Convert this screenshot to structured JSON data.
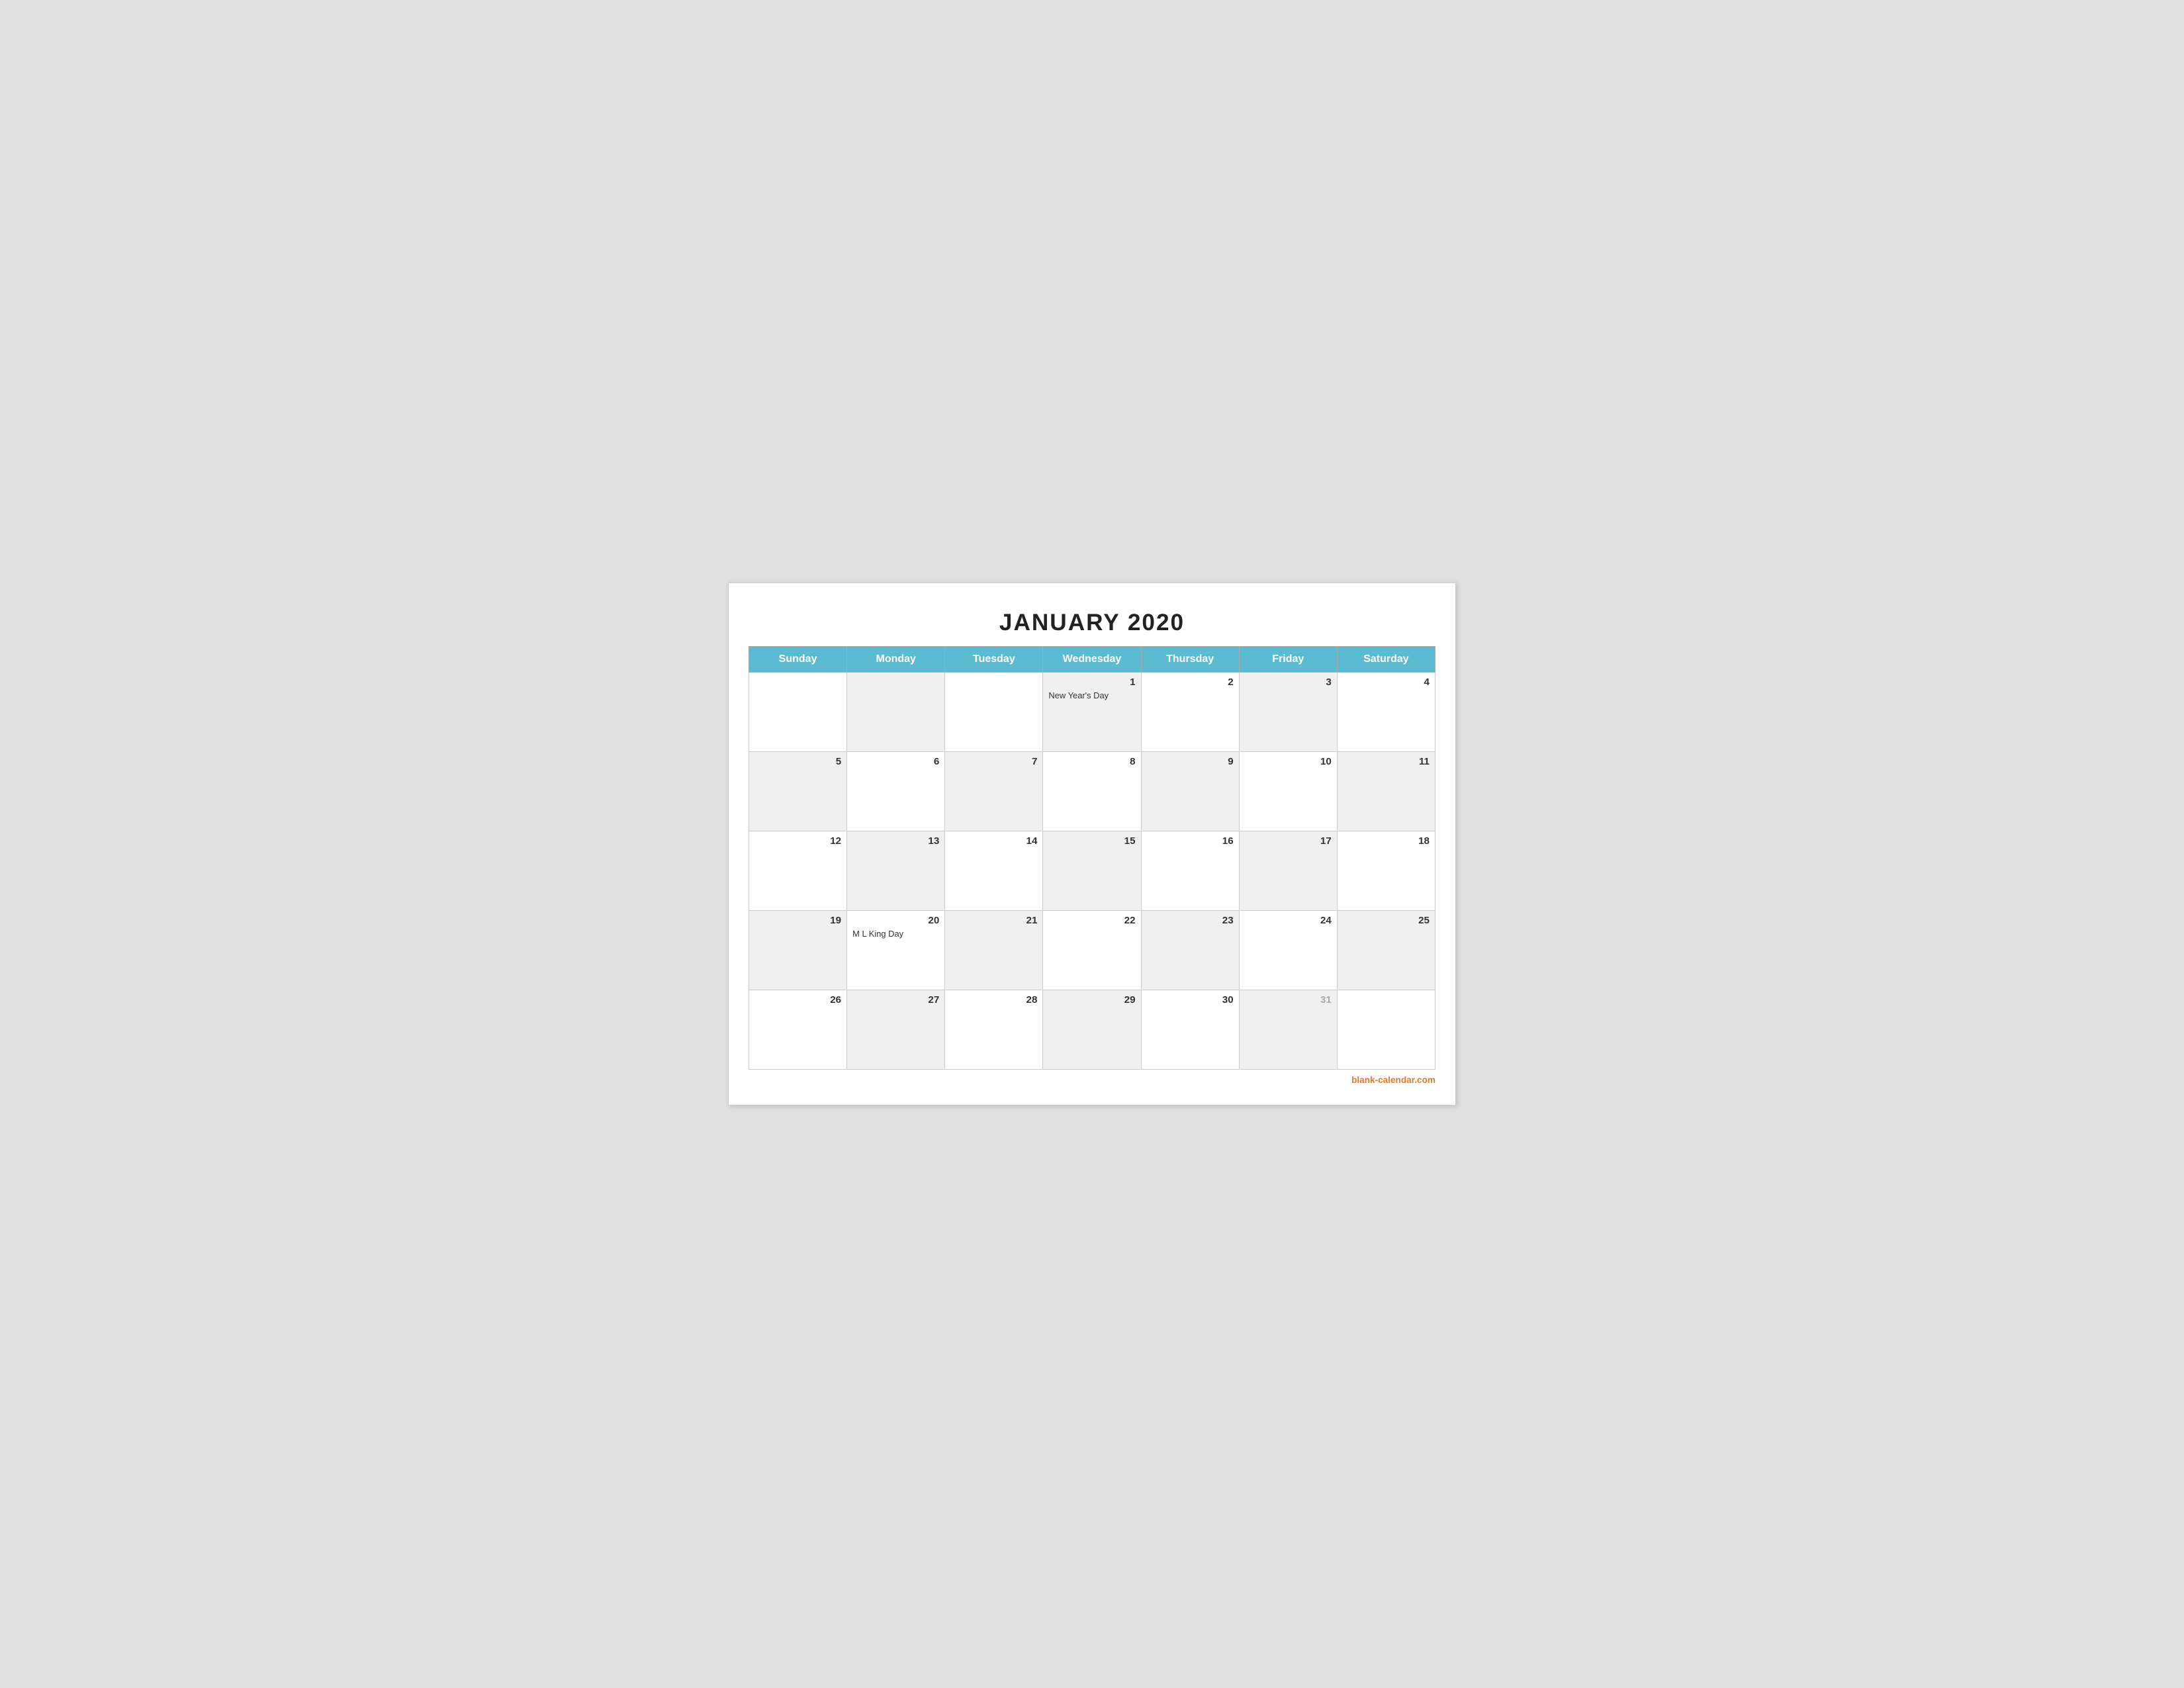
{
  "calendar": {
    "title": "JANUARY 2020",
    "headers": [
      "Sunday",
      "Monday",
      "Tuesday",
      "Wednesday",
      "Thursday",
      "Friday",
      "Saturday"
    ],
    "weeks": [
      [
        {
          "day": "",
          "holiday": "",
          "bg": "white"
        },
        {
          "day": "",
          "holiday": "",
          "bg": "gray"
        },
        {
          "day": "",
          "holiday": "",
          "bg": "white"
        },
        {
          "day": "1",
          "holiday": "New Year's Day",
          "bg": "gray"
        },
        {
          "day": "2",
          "holiday": "",
          "bg": "white"
        },
        {
          "day": "3",
          "holiday": "",
          "bg": "gray"
        },
        {
          "day": "4",
          "holiday": "",
          "bg": "white"
        }
      ],
      [
        {
          "day": "5",
          "holiday": "",
          "bg": "gray"
        },
        {
          "day": "6",
          "holiday": "",
          "bg": "white"
        },
        {
          "day": "7",
          "holiday": "",
          "bg": "gray"
        },
        {
          "day": "8",
          "holiday": "",
          "bg": "white"
        },
        {
          "day": "9",
          "holiday": "",
          "bg": "gray"
        },
        {
          "day": "10",
          "holiday": "",
          "bg": "white"
        },
        {
          "day": "11",
          "holiday": "",
          "bg": "gray"
        }
      ],
      [
        {
          "day": "12",
          "holiday": "",
          "bg": "white"
        },
        {
          "day": "13",
          "holiday": "",
          "bg": "gray"
        },
        {
          "day": "14",
          "holiday": "",
          "bg": "white"
        },
        {
          "day": "15",
          "holiday": "",
          "bg": "gray"
        },
        {
          "day": "16",
          "holiday": "",
          "bg": "white"
        },
        {
          "day": "17",
          "holiday": "",
          "bg": "gray"
        },
        {
          "day": "18",
          "holiday": "",
          "bg": "white"
        }
      ],
      [
        {
          "day": "19",
          "holiday": "",
          "bg": "gray"
        },
        {
          "day": "20",
          "holiday": "M L King Day",
          "bg": "white"
        },
        {
          "day": "21",
          "holiday": "",
          "bg": "gray"
        },
        {
          "day": "22",
          "holiday": "",
          "bg": "white"
        },
        {
          "day": "23",
          "holiday": "",
          "bg": "gray"
        },
        {
          "day": "24",
          "holiday": "",
          "bg": "white"
        },
        {
          "day": "25",
          "holiday": "",
          "bg": "gray"
        }
      ],
      [
        {
          "day": "26",
          "holiday": "",
          "bg": "white"
        },
        {
          "day": "27",
          "holiday": "",
          "bg": "gray"
        },
        {
          "day": "28",
          "holiday": "",
          "bg": "white"
        },
        {
          "day": "29",
          "holiday": "",
          "bg": "gray"
        },
        {
          "day": "30",
          "holiday": "",
          "bg": "white"
        },
        {
          "day": "31",
          "holiday": "",
          "dimmed": true,
          "bg": "gray"
        },
        {
          "day": "",
          "holiday": "",
          "bg": "white"
        }
      ]
    ],
    "footer": "blank-calendar.com"
  }
}
